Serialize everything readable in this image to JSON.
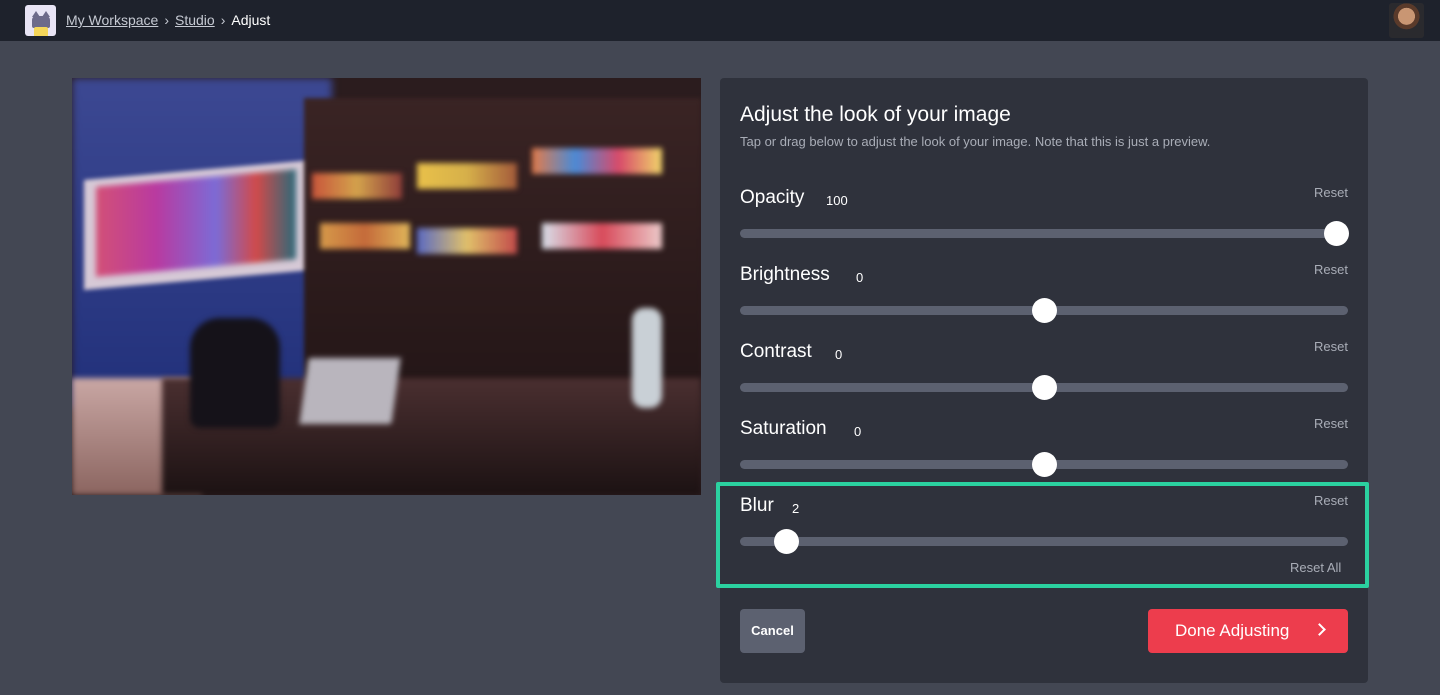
{
  "breadcrumb": {
    "workspace": "My Workspace",
    "studio": "Studio",
    "current": "Adjust",
    "separator": "›"
  },
  "panel": {
    "title": "Adjust the look of your image",
    "subtitle": "Tap or drag below to adjust the look of your image. Note that this is just a preview.",
    "reset_all_label": "Reset All"
  },
  "controls": [
    {
      "label": "Opacity",
      "value": "100",
      "reset_label": "Reset",
      "min": 0,
      "max": 100,
      "position": 100
    },
    {
      "label": "Brightness",
      "value": "0",
      "reset_label": "Reset",
      "min": -100,
      "max": 100,
      "position": 0
    },
    {
      "label": "Contrast",
      "value": "0",
      "reset_label": "Reset",
      "min": -100,
      "max": 100,
      "position": 0
    },
    {
      "label": "Saturation",
      "value": "0",
      "reset_label": "Reset",
      "min": -100,
      "max": 100,
      "position": 0
    },
    {
      "label": "Blur",
      "value": "2",
      "reset_label": "Reset",
      "min": 0,
      "max": 34,
      "position": 2
    }
  ],
  "buttons": {
    "cancel_label": "Cancel",
    "done_label": "Done Adjusting"
  },
  "colors": {
    "accent_highlight": "#2bd1a0",
    "done_button": "#ed3d4d",
    "topbar": "#1e222c",
    "background": "#434753",
    "panel": "#2f323c"
  },
  "icons": {
    "logo": "cat-logo-icon",
    "done_chevron": "chevron-right-icon"
  }
}
